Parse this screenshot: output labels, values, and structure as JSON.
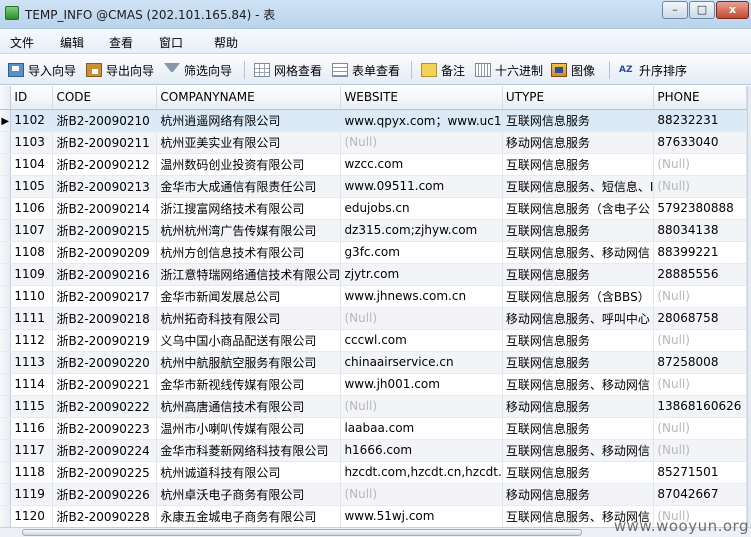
{
  "window": {
    "title": "TEMP_INFO @CMAS (202.101.165.84) - 表",
    "min_label": "–",
    "max_label": "□",
    "close_label": "x"
  },
  "menu": [
    "文件",
    "编辑",
    "查看",
    "窗口",
    "帮助"
  ],
  "toolbar": {
    "import_wizard": "导入向导",
    "export_wizard": "导出向导",
    "filter_wizard": "筛选向导",
    "grid_view": "网格查看",
    "form_view": "表单查看",
    "memo": "备注",
    "hex": "十六进制",
    "image": "图像",
    "sort_asc": "升序排序",
    "sort_icon_text": "AZ"
  },
  "table": {
    "columns": [
      "ID",
      "CODE",
      "COMPANYNAME",
      "WEBSITE",
      "UTYPE",
      "PHONE"
    ],
    "current_row_marker": "▶",
    "rows": [
      [
        "1102",
        "浙B2-20090210",
        "杭州逍遥网络有限公司",
        "www.qpyx.com；www.uc1",
        "互联网信息服务",
        "88232231"
      ],
      [
        "1103",
        "浙B2-20090211",
        "杭州亚美实业有限公司",
        "(Null)",
        "移动网信息服务",
        "87633040"
      ],
      [
        "1104",
        "浙B2-20090212",
        "温州数码创业投资有限公司",
        "wzcc.com",
        "互联网信息服务",
        "(Null)"
      ],
      [
        "1105",
        "浙B2-20090213",
        "金华市大成通信有限责任公司",
        "www.09511.com",
        "互联网信息服务、短信息、I",
        "(Null)"
      ],
      [
        "1106",
        "浙B2-20090214",
        "浙江搜富网络技术有限公司",
        "edujobs.cn",
        "互联网信息服务（含电子公",
        "5792380888"
      ],
      [
        "1107",
        "浙B2-20090215",
        "杭州杭州湾广告传媒有限公司",
        "dz315.com;zjhyw.com",
        "互联网信息服务",
        "88034138"
      ],
      [
        "1108",
        "浙B2-20090209",
        "杭州方创信息技术有限公司",
        "g3fc.com",
        "互联网信息服务、移动网信",
        "88399221"
      ],
      [
        "1109",
        "浙B2-20090216",
        "浙江意特瑞网络通信技术有限公司",
        "zjytr.com",
        "互联网信息服务",
        "28885556"
      ],
      [
        "1110",
        "浙B2-20090217",
        "金华市新闻发展总公司",
        "www.jhnews.com.cn",
        "互联网信息服务（含BBS）",
        "(Null)"
      ],
      [
        "1111",
        "浙B2-20090218",
        "杭州拓奇科技有限公司",
        "(Null)",
        "移动网信息服务、呼叫中心",
        "28068758"
      ],
      [
        "1112",
        "浙B2-20090219",
        "义乌中国小商品配送有限公司",
        "cccwl.com",
        "互联网信息服务",
        "(Null)"
      ],
      [
        "1113",
        "浙B2-20090220",
        "杭州中航服航空服务有限公司",
        "chinaairservice.cn",
        "互联网信息服务",
        "87258008"
      ],
      [
        "1114",
        "浙B2-20090221",
        "金华市新视线传媒有限公司",
        "www.jh001.com",
        "互联网信息服务、移动网信",
        "(Null)"
      ],
      [
        "1115",
        "浙B2-20090222",
        "杭州高唐通信技术有限公司",
        "(Null)",
        "移动网信息服务",
        "13868160626"
      ],
      [
        "1116",
        "浙B2-20090223",
        "温州市小喇叭传媒有限公司",
        "laabaa.com",
        "互联网信息服务",
        "(Null)"
      ],
      [
        "1117",
        "浙B2-20090224",
        "金华市科菱新网络科技有限公司",
        "h1666.com",
        "互联网信息服务、移动网信",
        "(Null)"
      ],
      [
        "1118",
        "浙B2-20090225",
        "杭州诚道科技有限公司",
        "hzcdt.com,hzcdt.cn,hzcdt.",
        "互联网信息服务",
        "85271501"
      ],
      [
        "1119",
        "浙B2-20090226",
        "杭州卓沃电子商务有限公司",
        "(Null)",
        "移动网信息服务",
        "87042667"
      ],
      [
        "1120",
        "浙B2-20090228",
        "永康五金城电子商务有限公司",
        "www.51wj.com",
        "互联网信息服务、移动网信",
        "(Null)"
      ]
    ]
  },
  "watermark": "www.wooyun.org"
}
